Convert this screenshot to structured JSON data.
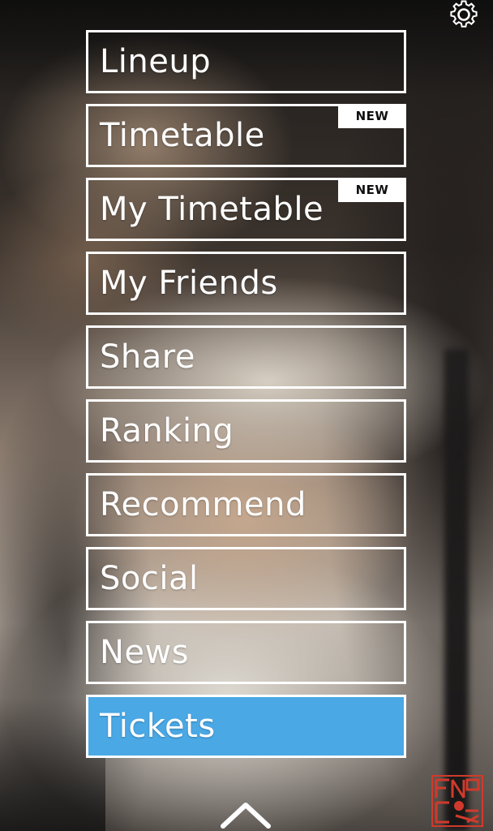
{
  "menu": {
    "items": [
      {
        "label": "Lineup",
        "badge": ""
      },
      {
        "label": "Timetable",
        "badge": "NEW"
      },
      {
        "label": "My Timetable",
        "badge": "NEW"
      },
      {
        "label": "My Friends",
        "badge": ""
      },
      {
        "label": "Share",
        "badge": ""
      },
      {
        "label": "Ranking",
        "badge": ""
      },
      {
        "label": "Recommend",
        "badge": ""
      },
      {
        "label": "Social",
        "badge": ""
      },
      {
        "label": "News",
        "badge": ""
      },
      {
        "label": "Tickets",
        "badge": ""
      }
    ],
    "highlight_color": "#4aa8e5"
  },
  "icons": {
    "settings": "gear-icon",
    "collapse": "chevron-up-icon",
    "logo": "app-logo"
  }
}
